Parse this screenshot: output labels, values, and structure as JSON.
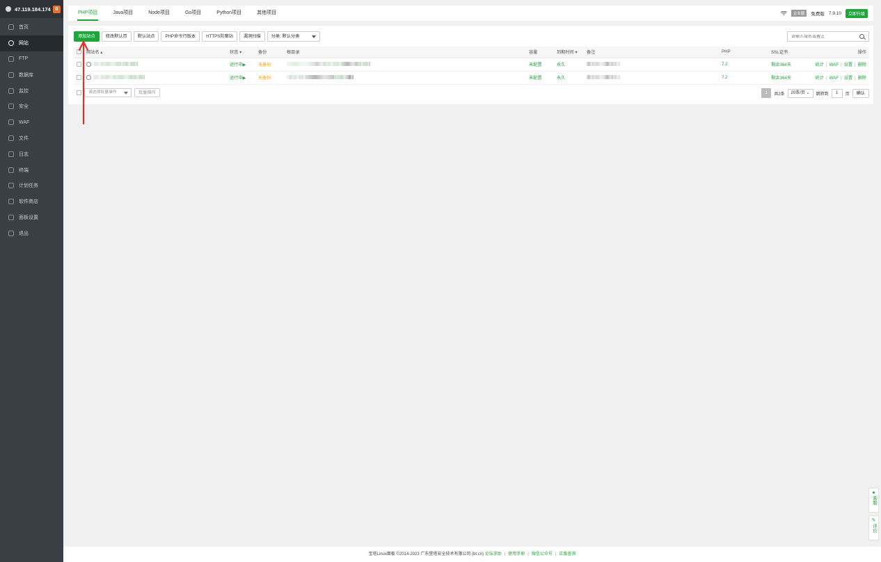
{
  "sidebar": {
    "ip": "47.119.184.174",
    "badge": "0",
    "items": [
      {
        "label": "首页",
        "icon": "home-icon"
      },
      {
        "label": "网站",
        "icon": "globe-icon"
      },
      {
        "label": "FTP",
        "icon": "ftp-icon"
      },
      {
        "label": "数据库",
        "icon": "database-icon"
      },
      {
        "label": "监控",
        "icon": "monitor-icon"
      },
      {
        "label": "安全",
        "icon": "shield-icon"
      },
      {
        "label": "WAF",
        "icon": "waf-icon"
      },
      {
        "label": "文件",
        "icon": "folder-icon"
      },
      {
        "label": "日志",
        "icon": "log-icon"
      },
      {
        "label": "终端",
        "icon": "terminal-icon"
      },
      {
        "label": "计划任务",
        "icon": "calendar-icon"
      },
      {
        "label": "软件商店",
        "icon": "grid-icon"
      },
      {
        "label": "面板设置",
        "icon": "settings-icon"
      },
      {
        "label": "退出",
        "icon": "logout-icon"
      }
    ],
    "active_index": 1
  },
  "tabs": [
    "PHP项目",
    "Java项目",
    "Node项目",
    "Go项目",
    "Python项目",
    "其他项目"
  ],
  "topright": {
    "enterprise": "企业版",
    "edition": "免费版",
    "version": "7.9.10",
    "upgrade": "立即升级"
  },
  "toolbar": {
    "add_site": "添加站点",
    "edit_default": "修改默认页",
    "default_site": "默认站点",
    "php_cli": "PHP命令行版本",
    "https": "HTTPS防窜站",
    "vuln_scan": "漏洞扫描",
    "category": "分类: 默认分类"
  },
  "search": {
    "placeholder": "请输入域名或备注"
  },
  "table": {
    "headers": [
      "网站名",
      "状态",
      "备份",
      "根目录",
      "容量",
      "到期时间",
      "备注",
      "PHP",
      "SSL证书",
      "操作"
    ],
    "rows": [
      {
        "status": "运行中▶",
        "backup": "无备份",
        "capacity": "未配置",
        "expire": "永久",
        "php": "7.2",
        "ssl": "剩余364天"
      },
      {
        "status": "运行中▶",
        "backup": "无备份",
        "capacity": "未配置",
        "expire": "永久",
        "php": "7.2",
        "ssl": "剩余364天"
      }
    ],
    "ops": [
      "统计",
      "WAF",
      "设置",
      "删除"
    ]
  },
  "bottom": {
    "batch_placeholder": "请选择批量操作",
    "batch_button": "批量操作",
    "page": "1",
    "total": "共2条",
    "per_page": "20条/页",
    "goto": "跳转到",
    "goto_value": "1",
    "page_unit": "页",
    "confirm": "确认"
  },
  "float": {
    "service": "客服",
    "rate": "评价"
  },
  "footer": {
    "copyright": "宝塔Linux面板 ©2014-2023 广东堡塔安全技术有限公司 (bt.cn)",
    "links": [
      "论坛求助",
      "使用手册",
      "微信公众号",
      "正版查询"
    ]
  },
  "colors": {
    "accent": "#20a53a",
    "sidebar": "#3a3f44",
    "arrow": "#e0302a",
    "warning": "#f0a020"
  }
}
